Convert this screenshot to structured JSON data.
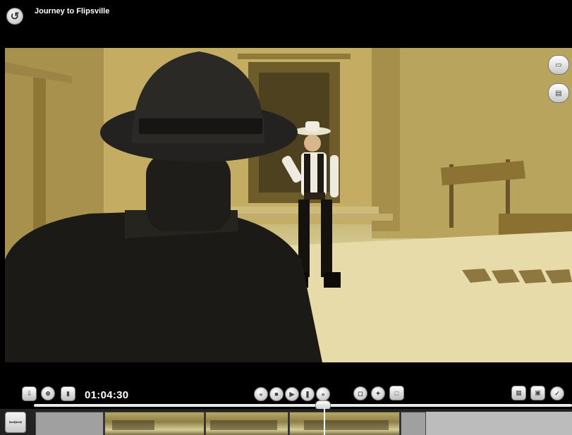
{
  "app": {
    "title": "Journey to Flipsville"
  },
  "player": {
    "timecode": "01:04:30"
  },
  "colors": {
    "background": "#000000",
    "scene_tint": "#c7b46a",
    "timeline_track": "#e9e9e9"
  },
  "icons": {
    "back": "back-arrow-icon",
    "side_top": "subtitle-card-icon",
    "side_bottom": "caption-card-icon",
    "left_controls": [
      "export-icon",
      "zoom-icon",
      "trash-icon"
    ],
    "transport": [
      "skip-back-icon",
      "stop-icon",
      "play-icon",
      "pause-icon",
      "skip-forward-icon"
    ],
    "view": [
      "camera-icon",
      "wand-icon",
      "frame-icon"
    ],
    "right_controls": [
      "clapper-icon",
      "save-icon",
      "check-icon"
    ],
    "timeline_mode": "storyboard-icon"
  },
  "timeline": {
    "clips": [
      "blank-clip",
      "wagon-clip",
      "street-clip",
      "town-clip",
      "blank-clip"
    ]
  }
}
